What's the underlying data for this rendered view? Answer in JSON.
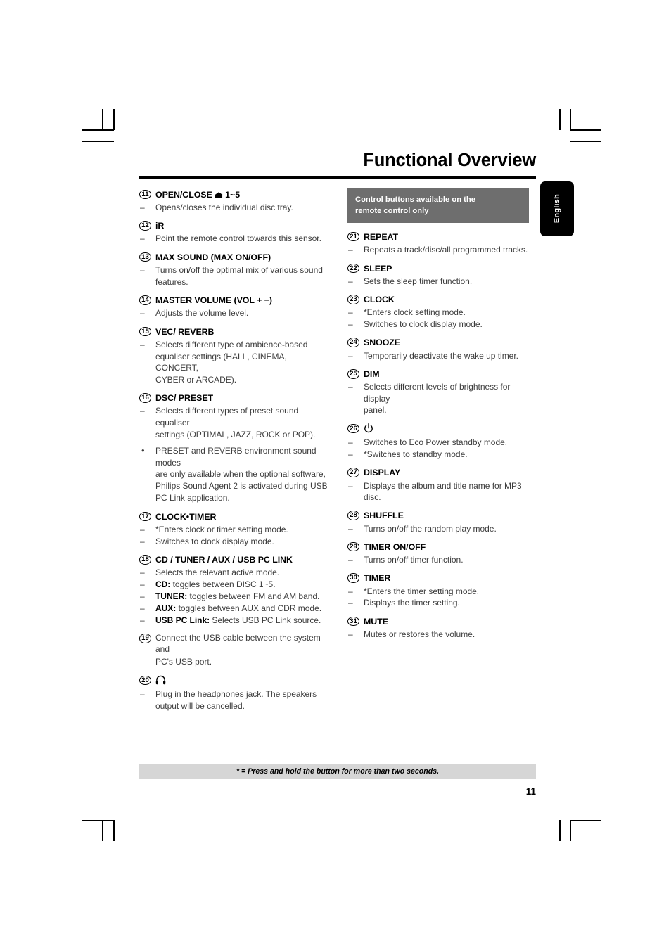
{
  "document": {
    "title": "Functional Overview",
    "language_tab": "English",
    "page_number": "11",
    "footnote": "* = Press and hold the button for more than two seconds."
  },
  "callout": {
    "line1": "Control buttons available on the",
    "line2": "remote control only"
  },
  "colors": {
    "callout_background": "#6e6e6e",
    "callout_text": "#ffffff",
    "footnote_background": "#d6d6d6",
    "rule": "#000000",
    "body_text": "#3c3c3c",
    "tab_background": "#000000"
  },
  "left_column": [
    {
      "number": "11",
      "title": "OPEN/CLOSE ⏏ 1~5",
      "lines": [
        {
          "marker": "–",
          "text": "Opens/closes the individual disc tray."
        }
      ]
    },
    {
      "number": "12",
      "title": "iR",
      "lines": [
        {
          "marker": "–",
          "text": "Point the remote control towards this sensor."
        }
      ]
    },
    {
      "number": "13",
      "title": "MAX SOUND (MAX ON/OFF)",
      "lines": [
        {
          "marker": "–",
          "text": "Turns on/off the optimal mix of various sound"
        },
        {
          "marker": "",
          "text": "features."
        }
      ]
    },
    {
      "number": "14",
      "title": "MASTER VOLUME (VOL + −)",
      "lines": [
        {
          "marker": "–",
          "text": "Adjusts the volume level."
        }
      ]
    },
    {
      "number": "15",
      "title": "VEC/ REVERB",
      "lines": [
        {
          "marker": "–",
          "text": "Selects different type of ambience-based"
        },
        {
          "marker": "",
          "text": "equaliser settings (HALL, CINEMA, CONCERT,"
        },
        {
          "marker": "",
          "text": "CYBER or ARCADE)."
        }
      ]
    },
    {
      "number": "16",
      "title": "DSC/ PRESET",
      "lines": [
        {
          "marker": "–",
          "text": "Selects different types of preset sound equaliser"
        },
        {
          "marker": "",
          "text": "settings (OPTIMAL, JAZZ, ROCK or POP)."
        },
        {
          "marker": "•",
          "text": "PRESET and REVERB environment sound modes",
          "spaced": true
        },
        {
          "marker": "",
          "text": "are only available when the optional software,"
        },
        {
          "marker": "",
          "text": "Philips Sound Agent 2 is activated during USB"
        },
        {
          "marker": "",
          "text": "PC Link application."
        }
      ]
    },
    {
      "number": "17",
      "title": "CLOCK•TIMER",
      "lines": [
        {
          "marker": "–",
          "text": "*Enters clock or timer setting mode."
        },
        {
          "marker": "–",
          "text": "Switches to clock display mode."
        }
      ]
    },
    {
      "number": "18",
      "title": "CD / TUNER / AUX / USB PC LINK",
      "lines": [
        {
          "marker": "–",
          "text": "Selects the relevant active mode."
        },
        {
          "marker": "–",
          "bold_lead": "CD:",
          "text": " toggles between DISC 1~5."
        },
        {
          "marker": "–",
          "bold_lead": "TUNER:",
          "text": " toggles between FM and AM band."
        },
        {
          "marker": "–",
          "bold_lead": "AUX:",
          "text": " toggles between AUX and CDR mode."
        },
        {
          "marker": "–",
          "bold_lead": "USB PC Link:",
          "text": " Selects USB PC Link source."
        }
      ]
    },
    {
      "number": "19",
      "title_plain": "Connect the USB cable between the system and",
      "lines": [
        {
          "marker": "",
          "text": "PC's USB port."
        }
      ]
    },
    {
      "number": "20",
      "title_icon": "headphones-icon",
      "lines": [
        {
          "marker": "–",
          "text": "Plug in the headphones jack.  The speakers"
        },
        {
          "marker": "",
          "text": "output will be cancelled."
        }
      ]
    }
  ],
  "right_column": [
    {
      "number": "21",
      "title": "REPEAT",
      "lines": [
        {
          "marker": "–",
          "text": "Repeats a track/disc/all programmed tracks."
        }
      ]
    },
    {
      "number": "22",
      "title": "SLEEP",
      "lines": [
        {
          "marker": "–",
          "text": "Sets the sleep timer function."
        }
      ]
    },
    {
      "number": "23",
      "title": "CLOCK",
      "lines": [
        {
          "marker": "–",
          "text": "*Enters clock setting mode."
        },
        {
          "marker": "–",
          "text": "Switches to clock display mode."
        }
      ]
    },
    {
      "number": "24",
      "title": "SNOOZE",
      "lines": [
        {
          "marker": "–",
          "text": "Temporarily deactivate the wake up timer."
        }
      ]
    },
    {
      "number": "25",
      "title": "DIM",
      "lines": [
        {
          "marker": "–",
          "text": "Selects different levels of brightness for display"
        },
        {
          "marker": "",
          "text": "panel."
        }
      ]
    },
    {
      "number": "26",
      "title_icon": "power-standby-icon",
      "lines": [
        {
          "marker": "–",
          "text": "Switches to Eco Power standby mode."
        },
        {
          "marker": "–",
          "text": "*Switches to standby mode."
        }
      ]
    },
    {
      "number": "27",
      "title": "DISPLAY",
      "lines": [
        {
          "marker": "–",
          "text": "Displays the album and title name for MP3 disc."
        }
      ]
    },
    {
      "number": "28",
      "title": "SHUFFLE",
      "lines": [
        {
          "marker": "–",
          "text": "Turns on/off the random play mode."
        }
      ]
    },
    {
      "number": "29",
      "title": "TIMER ON/OFF",
      "lines": [
        {
          "marker": "–",
          "text": "Turns on/off timer function."
        }
      ]
    },
    {
      "number": "30",
      "title": "TIMER",
      "lines": [
        {
          "marker": "–",
          "text": "*Enters the timer setting mode."
        },
        {
          "marker": "–",
          "text": "Displays the timer setting."
        }
      ]
    },
    {
      "number": "31",
      "title": "MUTE",
      "lines": [
        {
          "marker": "–",
          "text": "Mutes or restores the volume."
        }
      ]
    }
  ]
}
